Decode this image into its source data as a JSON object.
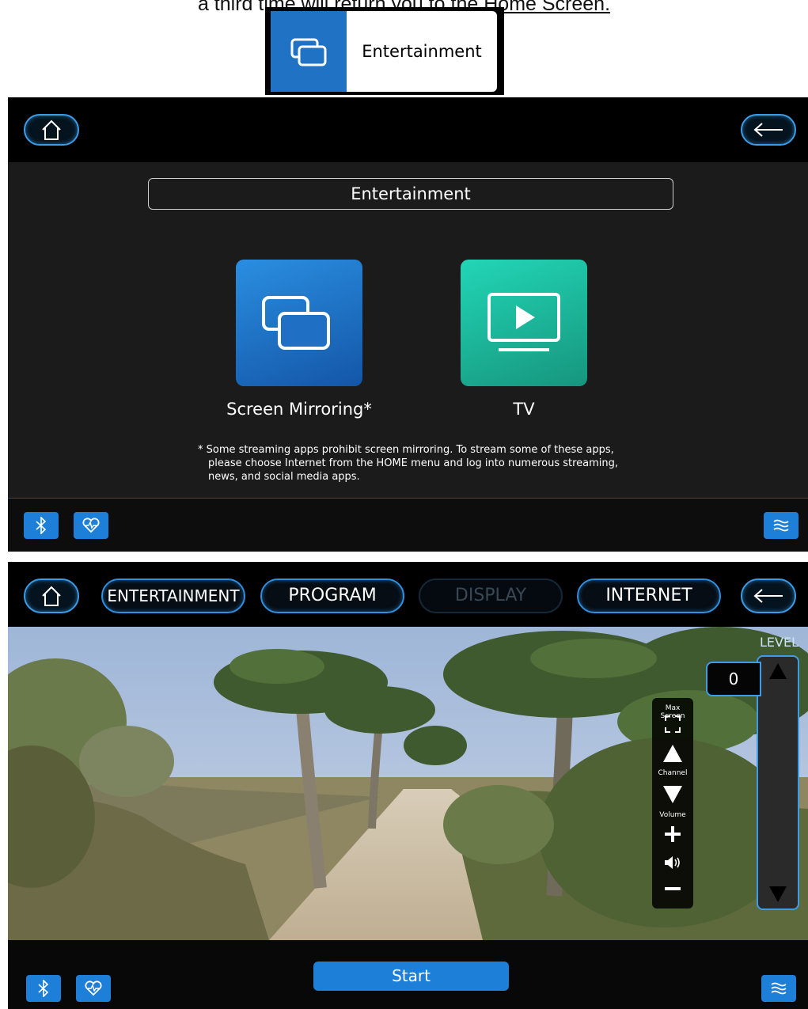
{
  "caption": {
    "before": "a third time will return ",
    "underlined": "you to the Home Screen."
  },
  "badge": {
    "label": "Entertainment"
  },
  "entertainment_screen": {
    "title": "Entertainment",
    "tiles": [
      {
        "label": "Screen Mirroring*",
        "icon": "screen-mirroring-icon",
        "color": "#1f6fc4"
      },
      {
        "label": "TV",
        "icon": "tv-play-icon",
        "color": "#1fb99b"
      }
    ],
    "footnote_line1": "* Some streaming apps prohibit screen mirroring. To stream some of these apps,",
    "footnote_line2": "please choose Internet from the HOME menu and log into numerous streaming,",
    "footnote_line3": "news, and social media apps."
  },
  "workout_screen": {
    "tabs": [
      {
        "label": "ENTERTAINMENT",
        "enabled": true
      },
      {
        "label": "PROGRAM",
        "enabled": true
      },
      {
        "label": "DISPLAY",
        "enabled": false
      },
      {
        "label": "INTERNET",
        "enabled": true
      }
    ],
    "level_label": "LEVEL",
    "level_value": "0",
    "media_controls": {
      "max_screen_label": "Max Screen",
      "channel_label": "Channel",
      "volume_label": "Volume"
    },
    "start_label": "Start"
  },
  "colors": {
    "accent": "#1e7fd8",
    "outline": "#3b9de8",
    "tv_tile": "#1fb99b",
    "mirror_tile": "#1f6fc4"
  }
}
